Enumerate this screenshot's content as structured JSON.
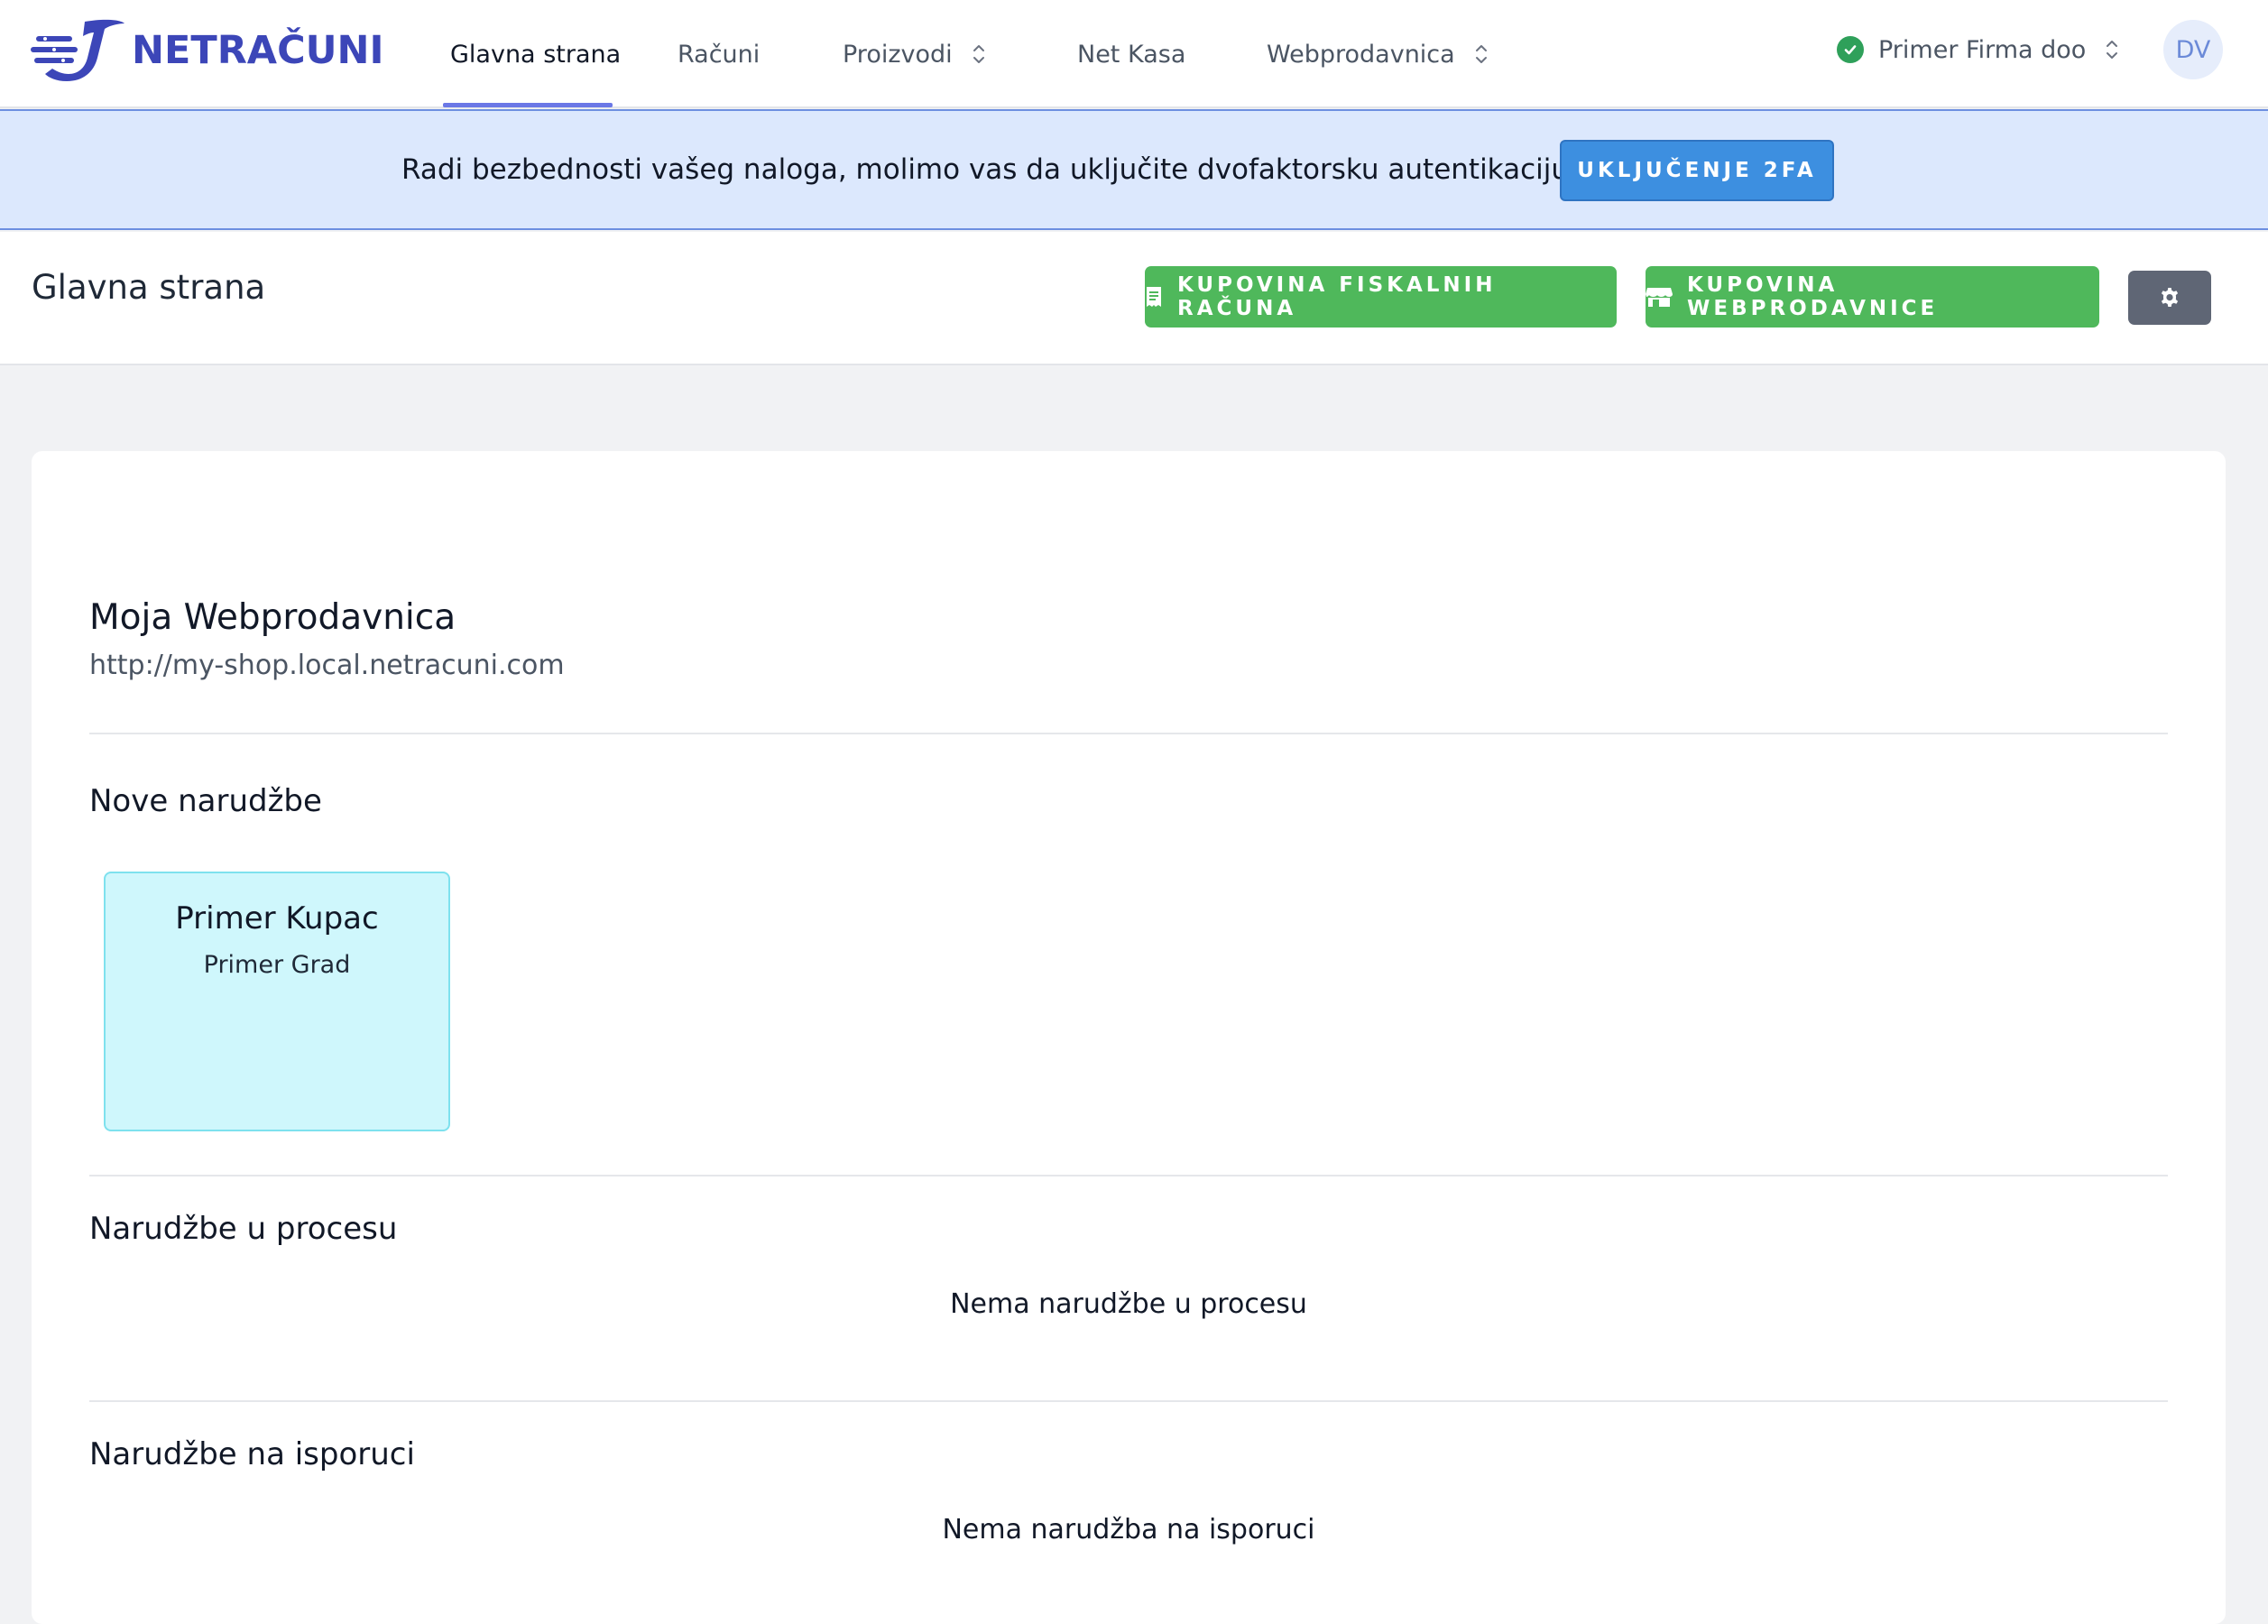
{
  "app": {
    "logo_text": "NETRAČUNI"
  },
  "nav": {
    "items": [
      {
        "label": "Glavna strana",
        "active": true,
        "dropdown": false
      },
      {
        "label": "Računi",
        "active": false,
        "dropdown": false
      },
      {
        "label": "Proizvodi",
        "active": false,
        "dropdown": true
      },
      {
        "label": "Net Kasa",
        "active": false,
        "dropdown": false
      },
      {
        "label": "Webprodavnica",
        "active": false,
        "dropdown": true
      }
    ],
    "company": "Primer Firma doo",
    "avatar_initials": "DV"
  },
  "banner": {
    "message": "Radi bezbednosti vašeg naloga, molimo vas da uključite dvofaktorsku autentikaciju!",
    "button_label": "UKLJUČENJE 2FA"
  },
  "header": {
    "title": "Glavna strana",
    "buy_receipts_label": "KUPOVINA FISKALNIH RAČUNA",
    "buy_shop_label": "KUPOVINA WEBPRODAVNICE"
  },
  "shop": {
    "name": "Moja Webprodavnica",
    "url": "http://my-shop.local.netracuni.com"
  },
  "sections": {
    "new_orders": {
      "title": "Nove narudžbe",
      "orders": [
        {
          "customer": "Primer Kupac",
          "city": "Primer Grad"
        }
      ]
    },
    "in_process": {
      "title": "Narudžbe u procesu",
      "empty": "Nema narudžbe u procesu"
    },
    "delivery": {
      "title": "Narudžbe na isporuci",
      "empty": "Nema narudžba na isporuci"
    }
  },
  "colors": {
    "brand": "#3c46b8",
    "accent": "#6b78e6",
    "banner_bg": "#dce8fd",
    "banner_button": "#3d8fe0",
    "green_button": "#4fb85b",
    "order_card": "#cff7fc"
  }
}
